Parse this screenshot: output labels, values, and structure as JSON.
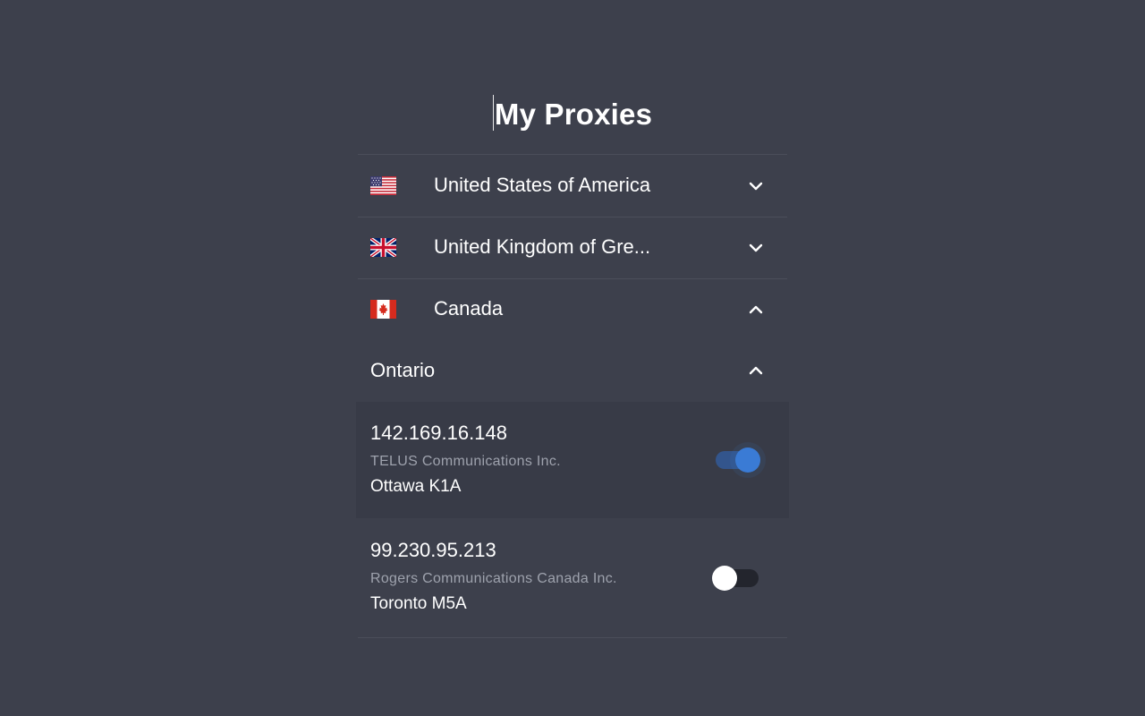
{
  "header": {
    "title": "My Proxies"
  },
  "countries": [
    {
      "name": "United States of America",
      "flag": "us-flag-icon",
      "chevron": "chevron-down-icon",
      "expanded": false
    },
    {
      "name": "United Kingdom of Gre...",
      "flag": "uk-flag-icon",
      "chevron": "chevron-down-icon",
      "expanded": false
    },
    {
      "name": "Canada",
      "flag": "canada-flag-icon",
      "chevron": "chevron-up-icon",
      "expanded": true
    }
  ],
  "region": {
    "name": "Ontario",
    "chevron": "chevron-up-icon",
    "expanded": true
  },
  "proxies": [
    {
      "ip": "142.169.16.148",
      "isp": "TELUS Communications Inc.",
      "location": "Ottawa K1A",
      "enabled": true
    },
    {
      "ip": "99.230.95.213",
      "isp": "Rogers Communications Canada Inc.",
      "location": "Toronto M5A",
      "enabled": false
    }
  ],
  "colors": {
    "background": "#3d404c",
    "selected_row": "#383b47",
    "accent": "#3a7bd5",
    "secondary_text": "#9ea2ad"
  }
}
